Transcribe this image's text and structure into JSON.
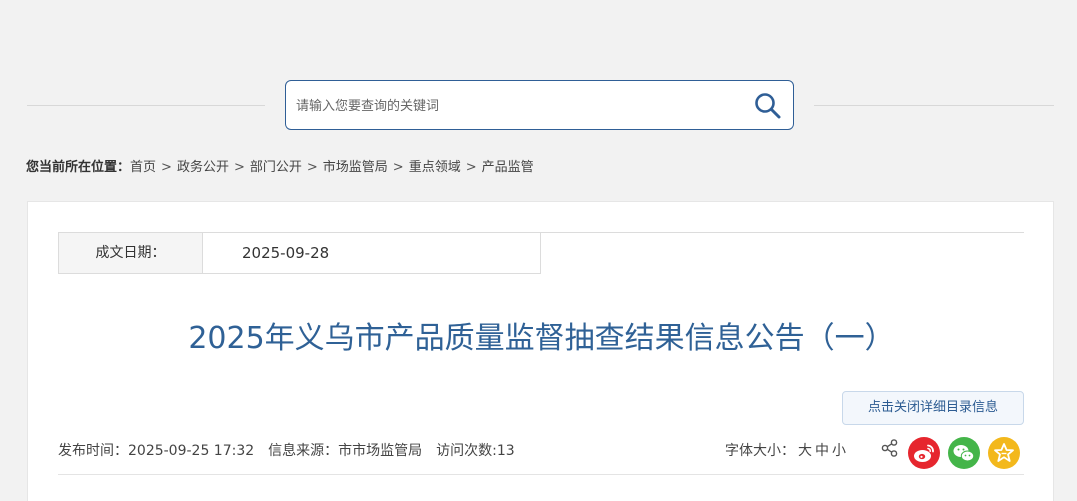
{
  "search": {
    "placeholder": "请输入您要查询的关键词"
  },
  "breadcrumb": {
    "lead": "您当前所在位置：",
    "items": [
      "首页",
      "政务公开",
      "部门公开",
      "市场监管局",
      "重点领域",
      "产品监管"
    ],
    "separator": ">"
  },
  "info_table": {
    "date_label": "成文日期：",
    "date_value": "2025-09-28"
  },
  "article": {
    "title": "2025年义乌市产品质量监督抽查结果信息公告（一）"
  },
  "toggle_label": "点击关闭详细目录信息",
  "meta": {
    "publish": "发布时间：2025-09-25 17:32",
    "source": "信息来源：市市场监管局",
    "visits": "访问次数:13"
  },
  "font_size": {
    "label": "字体大小：",
    "large": "大",
    "medium": "中",
    "small": "小"
  },
  "icons": [
    "search-icon",
    "share-icon",
    "weibo-icon",
    "wechat-icon",
    "star-icon"
  ],
  "colors": {
    "accent": "#2f6196",
    "weibo": "#e6262e",
    "wechat": "#44b549",
    "favorite": "#f3b81c"
  }
}
